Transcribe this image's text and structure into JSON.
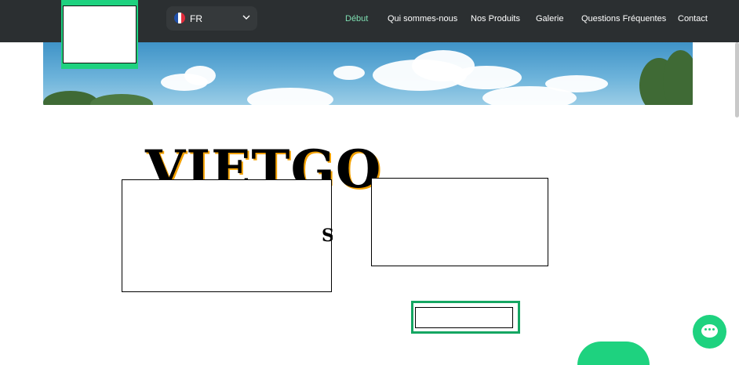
{
  "language": {
    "code": "FR"
  },
  "nav": {
    "items": [
      {
        "label": "Début",
        "active": true
      },
      {
        "label": "Qui sommes-nous",
        "active": false
      },
      {
        "label": "Nos Produits",
        "active": false
      },
      {
        "label": "Galerie",
        "active": false
      },
      {
        "label": "Questions Fréquentes",
        "active": false
      },
      {
        "label": "Contact",
        "active": false
      }
    ]
  },
  "hero": {
    "brand": "VIETGO",
    "fragment": "S"
  },
  "colors": {
    "accent": "#1ed27f",
    "topbar": "#2b2f31",
    "active_nav": "#7fe0b3",
    "button_border": "#15a662"
  },
  "icons": [
    "france-flag-icon",
    "chevron-down-icon",
    "chat-icon"
  ]
}
